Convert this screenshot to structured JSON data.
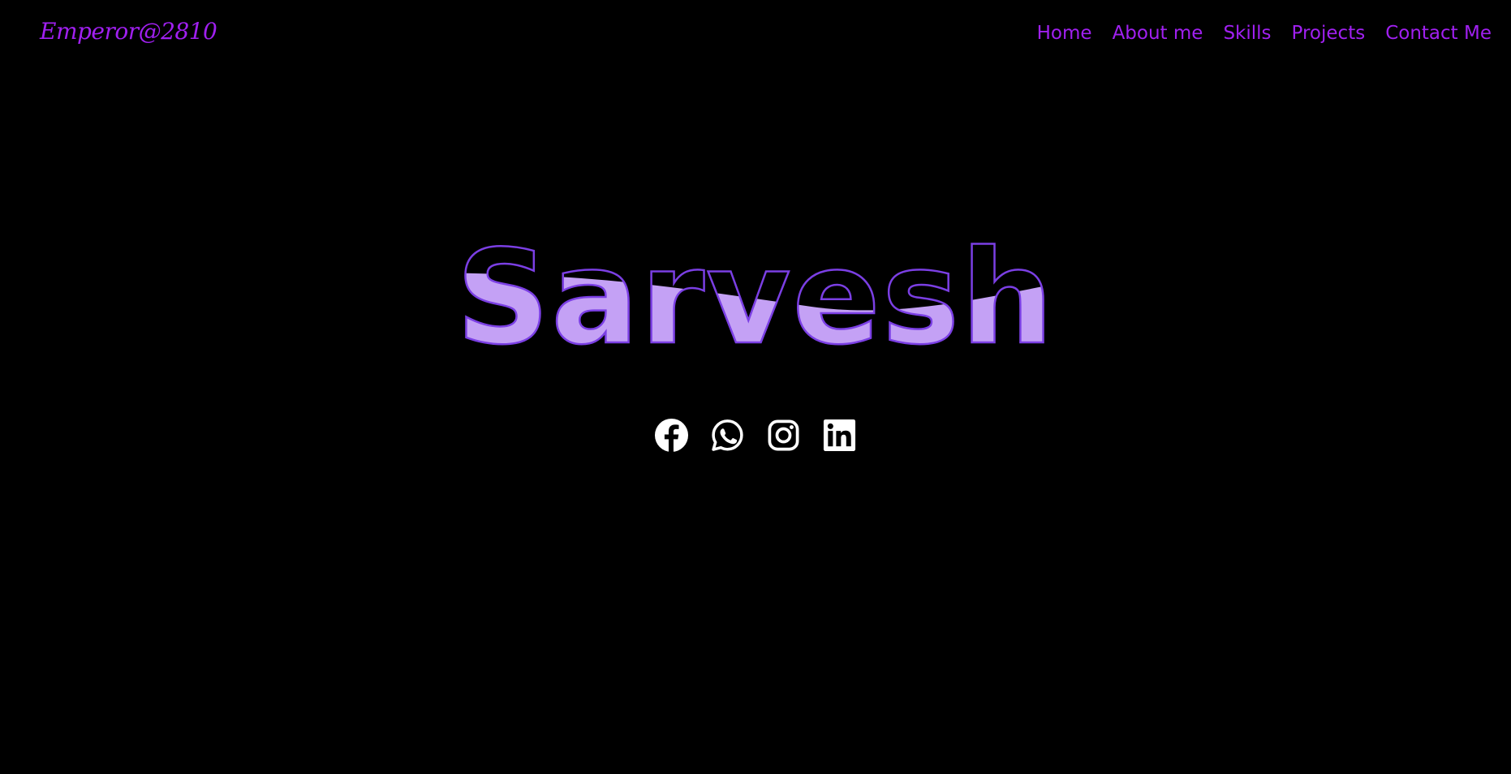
{
  "brand": {
    "logo_text": "Emperor@2810"
  },
  "nav": {
    "items": [
      {
        "label": "Home"
      },
      {
        "label": "About me"
      },
      {
        "label": "Skills"
      },
      {
        "label": "Projects"
      },
      {
        "label": "Contact Me"
      }
    ]
  },
  "hero": {
    "name": "Sarvesh",
    "fill_level_percent": 45
  },
  "socials": [
    {
      "icon": "facebook-icon"
    },
    {
      "icon": "whatsapp-icon"
    },
    {
      "icon": "instagram-icon"
    },
    {
      "icon": "linkedin-icon"
    }
  ],
  "colors": {
    "background": "#000000",
    "accent": "#a020f0",
    "hero_outline": "#7b3fe4",
    "hero_fill": "#c4a1f5",
    "icon": "#ffffff"
  }
}
